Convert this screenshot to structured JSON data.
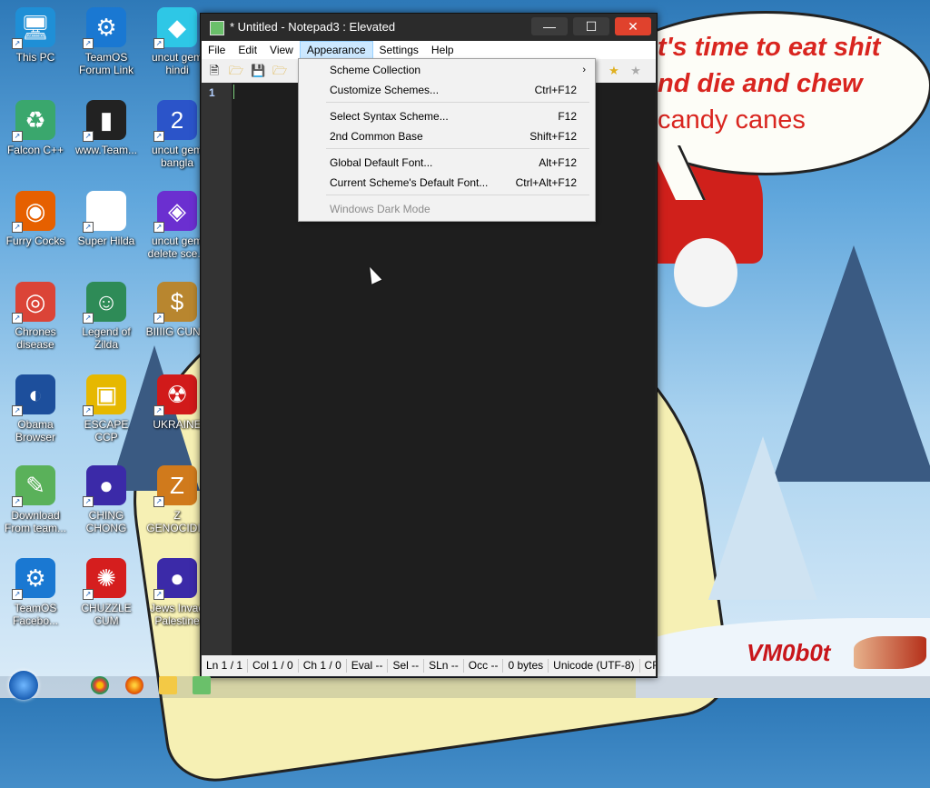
{
  "colors": {
    "menu_highlight": "#cce8ff",
    "close_button": "#e0422d",
    "editor_bg": "#1e1e1e",
    "wallpaper_text": "#d9251f"
  },
  "wallpaper": {
    "speech_lines": [
      "t's time to eat shit",
      "nd die and chew",
      "candy canes"
    ],
    "signature": "VM0b0t"
  },
  "desktop_icons": [
    {
      "label": "This PC",
      "icon": "computer-icon"
    },
    {
      "label": "TeamOS Forum Link",
      "icon": "gear-icon"
    },
    {
      "label": "uncut gem hindi",
      "icon": "diamond-icon"
    },
    {
      "label": "Falcon C++",
      "icon": "recycle-icon"
    },
    {
      "label": "www.Team...",
      "icon": "book-icon"
    },
    {
      "label": "uncut gem bangla",
      "icon": "number-2-icon"
    },
    {
      "label": "Furry Cocks",
      "icon": "firefox-icon"
    },
    {
      "label": "Super Hilda",
      "icon": "pixel-character-icon"
    },
    {
      "label": "uncut gem delete sce...",
      "icon": "gem-icon"
    },
    {
      "label": "Chrones disease",
      "icon": "chrome-icon"
    },
    {
      "label": "Legend of Zilda",
      "icon": "elf-icon"
    },
    {
      "label": "BIIIIG CUNN",
      "icon": "money-bag-icon"
    },
    {
      "label": "Obama Browser",
      "icon": "obama-logo-icon"
    },
    {
      "label": "ESCAPE CCP",
      "icon": "yellow-box-icon"
    },
    {
      "label": "UKRAINE",
      "icon": "radiation-icon"
    },
    {
      "label": "Download From team...",
      "icon": "notepad-icon"
    },
    {
      "label": "CHING CHONG",
      "icon": "orb-icon"
    },
    {
      "label": "Z GENOCIDIS",
      "icon": "z-block-icon"
    },
    {
      "label": "TeamOS Facebo...",
      "icon": "gear-icon"
    },
    {
      "label": "CHUZZLE CUM",
      "icon": "red-fuzzball-icon"
    },
    {
      "label": "Jews Invad Palestine",
      "icon": "orb-icon"
    }
  ],
  "window": {
    "title": "* Untitled - Notepad3 : Elevated",
    "controls": {
      "minimize": "—",
      "maximize": "☐",
      "close": "✕"
    }
  },
  "menubar": [
    {
      "label": "File",
      "active": false
    },
    {
      "label": "Edit",
      "active": false
    },
    {
      "label": "View",
      "active": false
    },
    {
      "label": "Appearance",
      "active": true
    },
    {
      "label": "Settings",
      "active": false
    },
    {
      "label": "Help",
      "active": false
    }
  ],
  "editor": {
    "line_number": "1"
  },
  "appearance_menu": {
    "items": [
      {
        "label": "Scheme Collection",
        "shortcut": "",
        "submenu": true,
        "disabled": false
      },
      {
        "label": "Customize Schemes...",
        "shortcut": "Ctrl+F12",
        "submenu": false,
        "disabled": false
      },
      {
        "label": "Select Syntax Scheme...",
        "shortcut": "F12",
        "submenu": false,
        "disabled": false
      },
      {
        "label": "2nd Common Base",
        "shortcut": "Shift+F12",
        "submenu": false,
        "disabled": false
      },
      {
        "label": "Global Default Font...",
        "shortcut": "Alt+F12",
        "submenu": false,
        "disabled": false
      },
      {
        "label": "Current Scheme's Default Font...",
        "shortcut": "Ctrl+Alt+F12",
        "submenu": false,
        "disabled": false
      },
      {
        "label": "Windows Dark Mode",
        "shortcut": "",
        "submenu": false,
        "disabled": true
      }
    ]
  },
  "statusbar": {
    "ln": "Ln  1 / 1",
    "col": "Col  1 / 0",
    "ch": "Ch  1 / 0",
    "eval": "Eval  --",
    "sel": "Sel  --",
    "sln": "SLn  --",
    "occ": "Occ  --",
    "size": "0 bytes",
    "encoding": "Unicode (UTF-8)",
    "eol": "CR+"
  }
}
